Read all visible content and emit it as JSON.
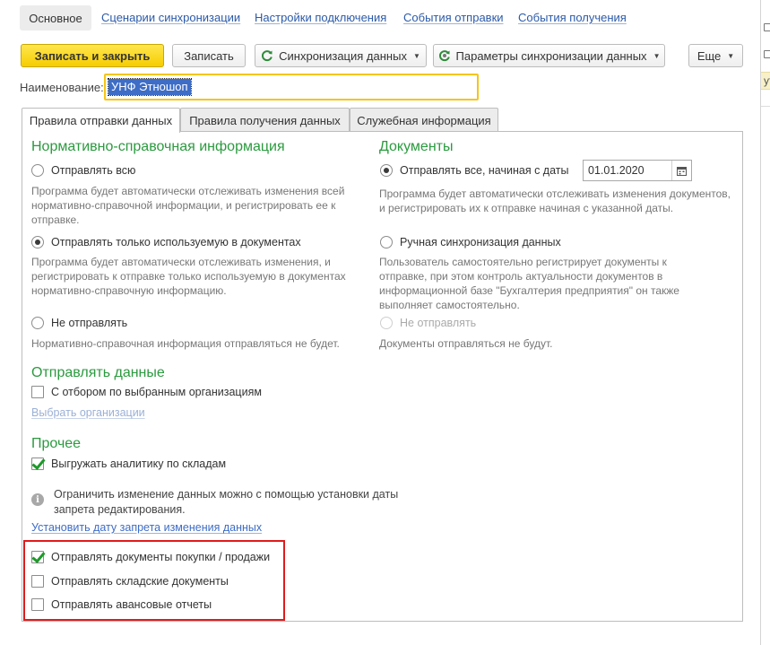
{
  "nav": {
    "main_tab": "Основное",
    "links": [
      "Сценарии синхронизации",
      "Настройки подключения",
      "События отправки",
      "События получения"
    ]
  },
  "toolbar": {
    "save_close": "Записать и закрыть",
    "save": "Записать",
    "sync": "Синхронизация данных",
    "sync_params": "Параметры синхронизации данных",
    "more": "Еще"
  },
  "name": {
    "label": "Наименование:",
    "value": "УНФ Этношоп"
  },
  "tabs": [
    "Правила отправки данных",
    "Правила получения данных",
    "Служебная информация"
  ],
  "nsi": {
    "title": "Нормативно-справочная информация",
    "opt_all": "Отправлять всю",
    "opt_all_hint": "Программа будет автоматически отслеживать изменения всей нормативно-справочной информации, и регистрировать ее к отправке.",
    "opt_used": "Отправлять только используемую в документах",
    "opt_used_hint": "Программа будет автоматически отслеживать изменения, и регистрировать к отправке только используемую в документах нормативно-справочную информацию.",
    "opt_none": "Не отправлять",
    "opt_none_hint": "Нормативно-справочная информация отправляться не будет."
  },
  "docs": {
    "title": "Документы",
    "opt_from_date": "Отправлять все, начиная с даты",
    "date_value": "01.01.2020",
    "opt_from_date_hint": "Программа будет автоматически отслеживать изменения документов, и регистрировать их к отправке начиная с указанной даты.",
    "opt_manual": "Ручная синхронизация данных",
    "opt_manual_hint": "Пользователь самостоятельно регистрирует документы к отправке, при этом контроль актуальности документов в информационной базе \"Бухгалтерия предприятия\" он также выполняет самостоятельно.",
    "opt_none": "Не отправлять",
    "opt_none_hint": "Документы отправляться не будут."
  },
  "send_data": {
    "title": "Отправлять данные",
    "filter_org": "С отбором по выбранным организациям",
    "choose_org": "Выбрать организации"
  },
  "other": {
    "title": "Прочее",
    "warehouse_analytics": "Выгружать аналитику по складам",
    "info_text": "Ограничить изменение данных можно с помощью установки даты запрета редактирования.",
    "set_date_link": "Установить дату запрета изменения данных",
    "send_purchase_sale": "Отправлять документы покупки / продажи",
    "send_warehouse": "Отправлять складские документы",
    "send_advance": "Отправлять авансовые отчеты"
  },
  "bg_strip": {
    "fragment": "ут"
  },
  "colors": {
    "accent_green": "#2b9a3f",
    "primary_yellow": "#f6cd00",
    "highlight_red": "#e01b1b",
    "link_blue": "#2b5aa8"
  }
}
